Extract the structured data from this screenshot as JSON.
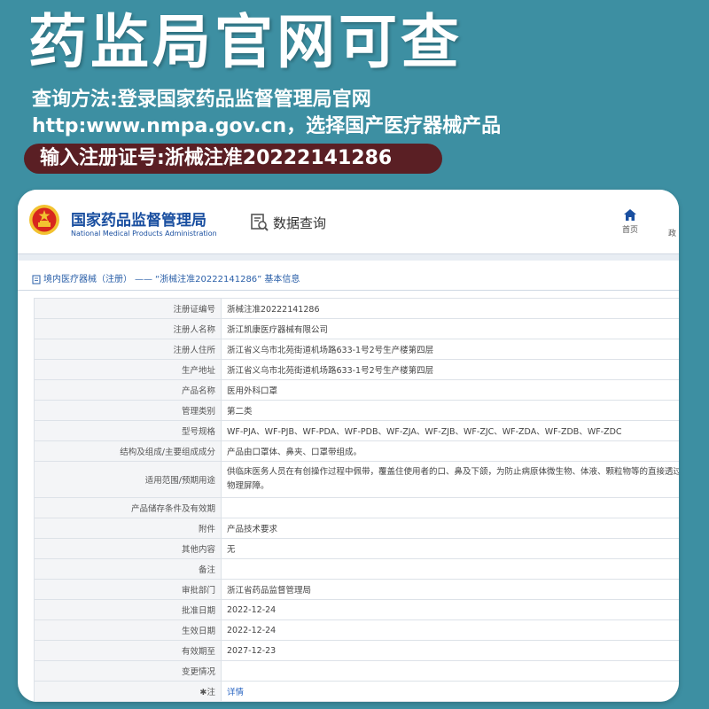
{
  "headline": "药监局官网可查",
  "method_line": "查询方法:登录国家药品监督管理局官网",
  "method_url_line": "http:www.nmpa.gov.cn，选择国产医疗器械产品",
  "reg_banner": "输入注册证号:浙械注准20222141286",
  "site": {
    "name_cn": "国家药品监督管理局",
    "name_en": "National Medical Products Administration",
    "emblem_icon": "national-emblem-icon",
    "data_query_label": "数据查询",
    "home_label": "首页",
    "nav_partial_label": "政"
  },
  "breadcrumb": {
    "category": "境内医疗器械（注册）",
    "separator": "——",
    "record": "“浙械注准20222141286”",
    "suffix": "基本信息"
  },
  "rows": [
    {
      "label": "注册证编号",
      "value": "浙械注准20222141286"
    },
    {
      "label": "注册人名称",
      "value": "浙江凯康医疗器械有限公司"
    },
    {
      "label": "注册人住所",
      "value": "浙江省义乌市北苑街道机场路633-1号2号生产楼第四层"
    },
    {
      "label": "生产地址",
      "value": "浙江省义乌市北苑街道机场路633-1号2号生产楼第四层"
    },
    {
      "label": "产品名称",
      "value": "医用外科口罩"
    },
    {
      "label": "管理类别",
      "value": "第二类"
    },
    {
      "label": "型号规格",
      "value": "WF-PJA、WF-PJB、WF-PDA、WF-PDB、WF-ZJA、WF-ZJB、WF-ZJC、WF-ZDA、WF-ZDB、WF-ZDC"
    },
    {
      "label": "结构及组成/主要组成成分",
      "value": "产品由口罩体、鼻夹、口罩带组成。"
    },
    {
      "label": "适用范围/预期用途",
      "value": "供临床医务人员在有创操作过程中佩带，覆盖住使用者的口、鼻及下颌，为防止病原体微生物、体液、颗粒物等的直接透过提供物理屏障。"
    },
    {
      "label": "产品储存条件及有效期",
      "value": ""
    },
    {
      "label": "附件",
      "value": "产品技术要求"
    },
    {
      "label": "其他内容",
      "value": "无"
    },
    {
      "label": "备注",
      "value": ""
    },
    {
      "label": "审批部门",
      "value": "浙江省药品监督管理局"
    },
    {
      "label": "批准日期",
      "value": "2022-12-24"
    },
    {
      "label": "生效日期",
      "value": "2022-12-24"
    },
    {
      "label": "有效期至",
      "value": "2027-12-23"
    },
    {
      "label": "变更情况",
      "value": ""
    },
    {
      "label": "注",
      "value": "详情"
    }
  ],
  "colors": {
    "background": "#3d8fa2",
    "banner": "#5a1f24",
    "site_blue": "#1a4fa0"
  }
}
